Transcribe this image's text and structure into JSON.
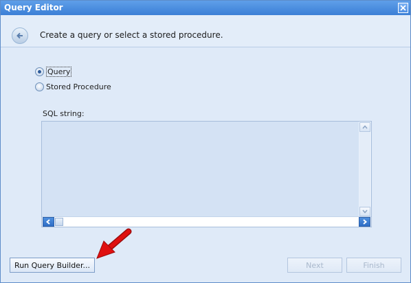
{
  "window": {
    "title": "Query Editor"
  },
  "header": {
    "instruction": "Create a query or select a stored procedure."
  },
  "options": [
    {
      "label": "Query",
      "checked": true
    },
    {
      "label": "Stored Procedure",
      "checked": false
    }
  ],
  "sql": {
    "label": "SQL string:",
    "value": ""
  },
  "buttons": {
    "run_query_builder": "Run Query Builder...",
    "next": "Next",
    "finish": "Finish"
  },
  "colors": {
    "annotation_arrow": "#e01010",
    "titlebar": "#4a8ddf"
  },
  "icons": [
    "close-icon",
    "back-arrow-icon",
    "scroll-up-icon",
    "scroll-down-icon",
    "scroll-left-icon",
    "scroll-right-icon",
    "annotation-arrow-icon"
  ]
}
